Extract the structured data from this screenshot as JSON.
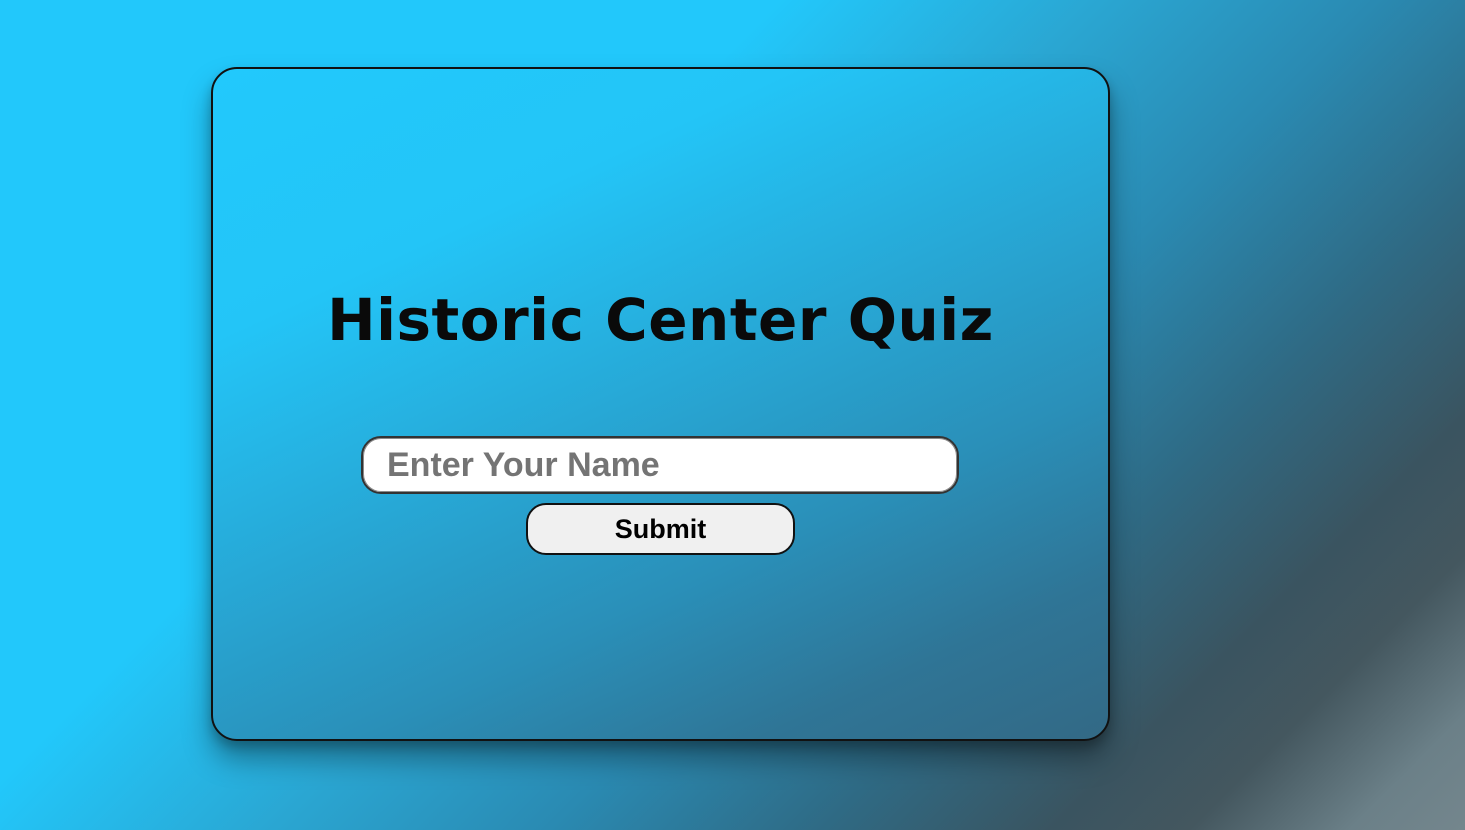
{
  "quiz": {
    "title": "Historic Center Quiz",
    "name_input": {
      "value": "",
      "placeholder": "Enter Your Name"
    },
    "submit_label": "Submit"
  },
  "colors": {
    "background_top_left": "#22c8fb",
    "background_bottom_right": "#74868d",
    "card_border": "#111111",
    "input_background": "#ffffff",
    "button_background": "#f0f0f0"
  }
}
